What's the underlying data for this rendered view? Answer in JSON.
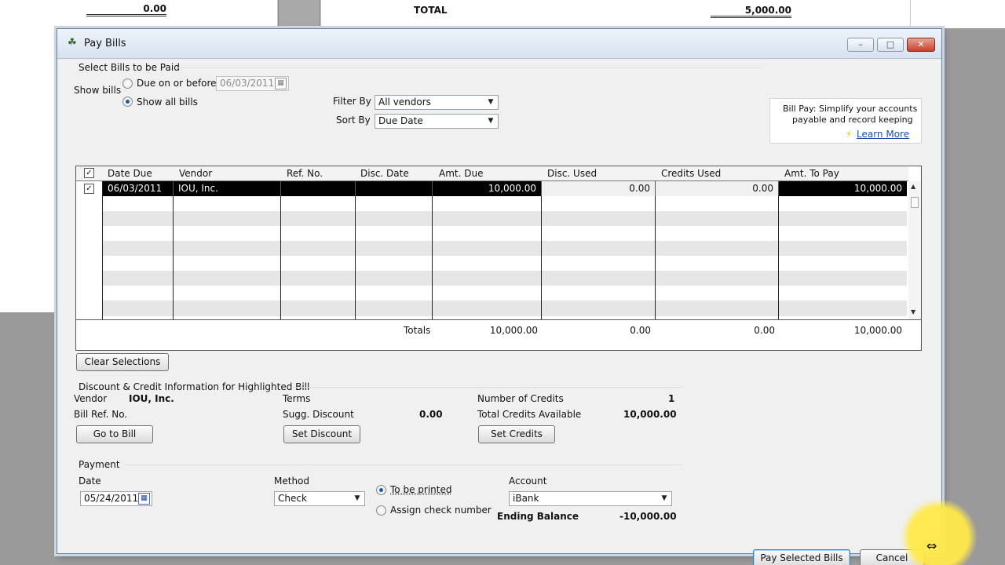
{
  "background": {
    "left_amount": "0.00",
    "total_label": "TOTAL",
    "total_amount": "5,000.00"
  },
  "window": {
    "title": "Pay Bills"
  },
  "select_bills": {
    "section_label": "Select Bills to be Paid",
    "show_bills_label": "Show bills",
    "due_on_before_label": "Due on or before",
    "due_date_value": "06/03/2011",
    "show_all_label": "Show all bills",
    "filter_by_label": "Filter By",
    "filter_by_value": "All vendors",
    "sort_by_label": "Sort By",
    "sort_by_value": "Due Date"
  },
  "promo": {
    "line1": "Bill Pay: Simplify your accounts",
    "line2": "payable and record keeping",
    "link": "Learn More"
  },
  "grid": {
    "columns": [
      "Date Due",
      "Vendor",
      "Ref. No.",
      "Disc. Date",
      "Amt. Due",
      "Disc. Used",
      "Credits Used",
      "Amt. To Pay"
    ],
    "rows": [
      {
        "checked": true,
        "date_due": "06/03/2011",
        "vendor": "IOU, Inc.",
        "ref_no": "",
        "disc_date": "",
        "amt_due": "10,000.00",
        "disc_used": "0.00",
        "credits_used": "0.00",
        "amt_to_pay": "10,000.00"
      }
    ],
    "totals_label": "Totals",
    "totals": {
      "amt_due": "10,000.00",
      "disc_used": "0.00",
      "credits_used": "0.00",
      "amt_to_pay": "10,000.00"
    }
  },
  "clear_selections_label": "Clear Selections",
  "discount_credit": {
    "section_label": "Discount & Credit Information for Highlighted Bill",
    "vendor_label": "Vendor",
    "vendor_value": "IOU, Inc.",
    "bill_ref_label": "Bill Ref. No.",
    "terms_label": "Terms",
    "sugg_discount_label": "Sugg. Discount",
    "sugg_discount_value": "0.00",
    "num_credits_label": "Number of Credits",
    "num_credits_value": "1",
    "total_credits_label": "Total Credits Available",
    "total_credits_value": "10,000.00",
    "go_to_bill_label": "Go to Bill",
    "set_discount_label": "Set Discount",
    "set_credits_label": "Set Credits"
  },
  "payment": {
    "section_label": "Payment",
    "date_label": "Date",
    "date_value": "05/24/2011",
    "method_label": "Method",
    "method_value": "Check",
    "to_be_printed_label": "To be printed",
    "assign_check_label": "Assign check number",
    "account_label": "Account",
    "account_value": "iBank",
    "ending_balance_label": "Ending Balance",
    "ending_balance_value": "-10,000.00"
  },
  "footer": {
    "pay_selected_label": "Pay Selected Bills",
    "cancel_label": "Cancel"
  }
}
